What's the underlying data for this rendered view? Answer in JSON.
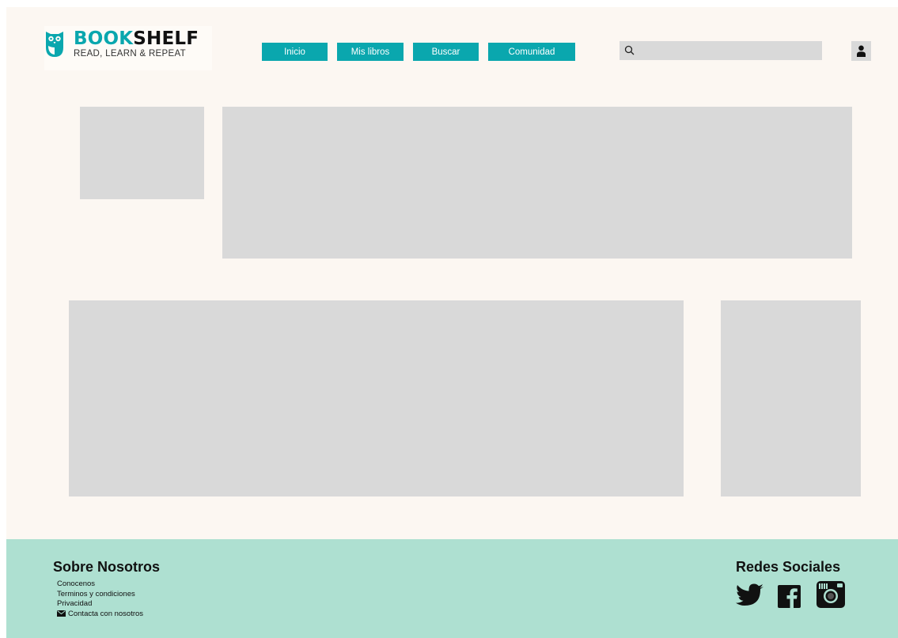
{
  "brand": {
    "title_part1": "BOOK",
    "title_part2": "SHELF",
    "tagline": "READ, LEARN & REPEAT",
    "accent_color": "#0aa7ae"
  },
  "nav": {
    "items": [
      {
        "label": "Inicio"
      },
      {
        "label": "Mis libros"
      },
      {
        "label": "Buscar"
      },
      {
        "label": "Comunidad"
      }
    ]
  },
  "search": {
    "value": "",
    "placeholder": "",
    "icon": "search-icon"
  },
  "user": {
    "icon": "user-icon"
  },
  "footer": {
    "about_title": "Sobre Nosotros",
    "links": [
      {
        "label": "Conocenos"
      },
      {
        "label": "Terminos y condiciones"
      },
      {
        "label": "Privacidad"
      },
      {
        "label": "Contacta con nosotros",
        "icon": "mail-icon"
      }
    ],
    "social_title": "Redes Sociales",
    "social_icons": [
      "twitter-icon",
      "facebook-icon",
      "instagram-icon"
    ],
    "background_color": "#aee0d1"
  },
  "colors": {
    "page_bg": "#fcf7f2",
    "placeholder": "#d9d9d9"
  }
}
